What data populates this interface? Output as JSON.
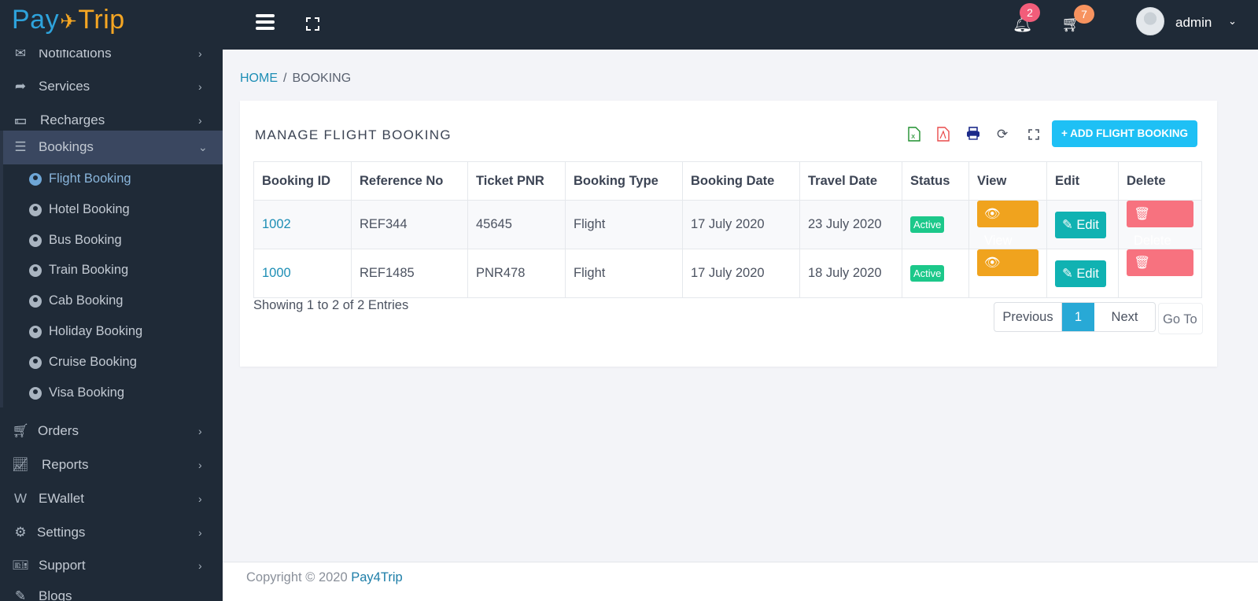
{
  "header": {
    "logo": {
      "part1": "Pay",
      "part2": "4",
      "part3": "Trip"
    },
    "notifications_count": "2",
    "cart_count": "7",
    "user_name": "admin",
    "colors": {
      "bar_bg": "#1f2a37",
      "notif_badge": "#f25d7a",
      "cart_badge": "#f7935f"
    }
  },
  "sidebar": {
    "items_top": [
      {
        "label": "Notifications",
        "icon": "envelope-icon"
      },
      {
        "label": "Services",
        "icon": "share-icon"
      },
      {
        "label": "Recharges",
        "icon": "money-icon"
      },
      {
        "label": "Bookings",
        "icon": "server-icon",
        "expanded": true
      }
    ],
    "bookings_sub": [
      {
        "label": "Flight Booking",
        "active": true
      },
      {
        "label": "Hotel Booking"
      },
      {
        "label": "Bus Booking"
      },
      {
        "label": "Train Booking"
      },
      {
        "label": "Cab Booking"
      },
      {
        "label": "Holiday Booking"
      },
      {
        "label": "Cruise Booking"
      },
      {
        "label": "Visa Booking"
      }
    ],
    "items_bottom": [
      {
        "label": "Orders",
        "icon": "cart-icon"
      },
      {
        "label": "Reports",
        "icon": "chart-icon"
      },
      {
        "label": "EWallet",
        "icon": "wallet-icon"
      },
      {
        "label": "Settings",
        "icon": "gear-icon"
      },
      {
        "label": "Support",
        "icon": "ticket-icon"
      },
      {
        "label": "Blogs",
        "icon": "pen-icon"
      }
    ]
  },
  "breadcrumb": {
    "home": "HOME",
    "separator": "/",
    "current": "BOOKING"
  },
  "card": {
    "title": "MANAGE FLIGHT BOOKING",
    "add_button": "+ ADD FLIGHT BOOKING",
    "tools": [
      "excel-icon",
      "pdf-icon",
      "print-icon",
      "refresh-icon",
      "fullscreen-icon"
    ]
  },
  "table": {
    "headers": [
      "Booking ID",
      "Reference No",
      "Ticket PNR",
      "Booking Type",
      "Booking Date",
      "Travel Date",
      "Status",
      "View",
      "Edit",
      "Delete"
    ],
    "rows": [
      {
        "id": "1002",
        "ref": "REF344",
        "pnr": "45645",
        "type": "Flight",
        "booking_date": "17 July 2020",
        "travel_date": "23 July 2020",
        "status": "Active",
        "view": "View",
        "edit": "Edit",
        "delete": "Delete"
      },
      {
        "id": "1000",
        "ref": "REF1485",
        "pnr": "PNR478",
        "type": "Flight",
        "booking_date": "17 July 2020",
        "travel_date": "18 July 2020",
        "status": "Active",
        "view": "View",
        "edit": "Edit",
        "delete": "Delete"
      }
    ]
  },
  "pagination": {
    "summary": "Showing 1 to 2 of 2 Entries",
    "previous": "Previous",
    "current_page": "1",
    "next": "Next",
    "goto": "Go To"
  },
  "footer": {
    "text": "Copyright © 2020",
    "brand": "Pay4Trip"
  }
}
